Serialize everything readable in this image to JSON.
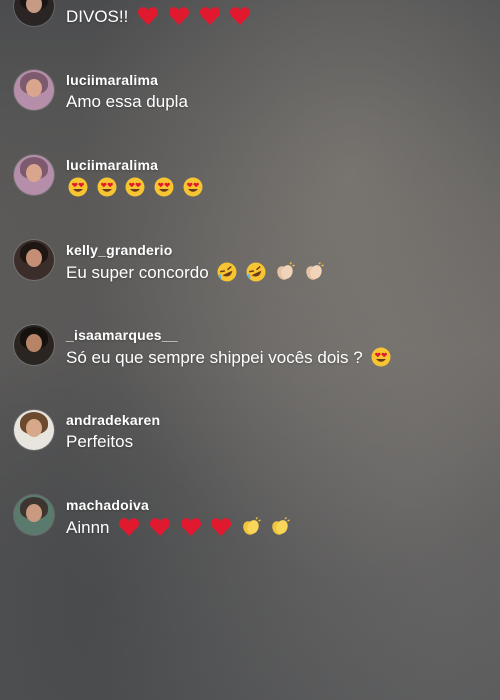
{
  "comments": [
    {
      "username": "",
      "text": "DIVOS!!",
      "emojis": [
        "heart-icon",
        "heart-icon",
        "heart-icon",
        "heart-icon"
      ]
    },
    {
      "username": "luciimaralima",
      "text": "Amo essa dupla",
      "emojis": []
    },
    {
      "username": "luciimaralima",
      "text": "",
      "emojis": [
        "heart-eyes-icon",
        "heart-eyes-icon",
        "heart-eyes-icon",
        "heart-eyes-icon",
        "heart-eyes-icon"
      ]
    },
    {
      "username": "kelly_granderio",
      "text": "Eu super concordo",
      "emojis": [
        "rofl-icon",
        "rofl-icon",
        "clap-icon",
        "clap-icon"
      ]
    },
    {
      "username": "_isaamarques__",
      "text": "Só eu que sempre shippei vocês dois ?",
      "emojis": [
        "heart-eyes-icon"
      ]
    },
    {
      "username": "andradekaren",
      "text": "Perfeitos",
      "emojis": []
    },
    {
      "username": "machadoiva",
      "text": "Ainnn",
      "emojis": [
        "heart-icon",
        "heart-icon",
        "heart-icon",
        "heart-icon",
        "clap-icon",
        "clap-icon"
      ]
    }
  ],
  "colors": {
    "heart": "#e0192f",
    "emoji_yellow": "#f7c531",
    "text": "#ffffff"
  }
}
